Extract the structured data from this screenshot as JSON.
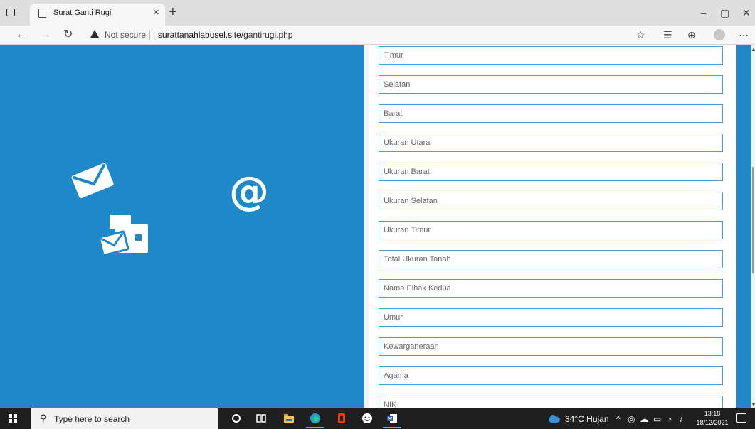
{
  "browser": {
    "tab_title": "Surat Ganti Rugi",
    "tab_close": "×",
    "new_tab": "+",
    "not_secure": "Not secure",
    "url_domain": "surattanahlabusel.site",
    "url_path": "/gantirugi.php",
    "window_controls": [
      "–",
      "▢",
      "✕"
    ],
    "tools": [
      "☆",
      "☰",
      "⊕",
      "⋯"
    ]
  },
  "form": {
    "fields": [
      {
        "placeholder": "Timur"
      },
      {
        "placeholder": "Selatan"
      },
      {
        "placeholder": "Barat"
      },
      {
        "placeholder": "Ukuran Utara"
      },
      {
        "placeholder": "Ukuran Barat"
      },
      {
        "placeholder": "Ukuran Selatan"
      },
      {
        "placeholder": "Ukuran Timur"
      },
      {
        "placeholder": "Total Ukuran Tanah"
      },
      {
        "placeholder": "Nama Pihak Kedua"
      },
      {
        "placeholder": "Umur"
      },
      {
        "placeholder": "Kewarganeraan"
      },
      {
        "placeholder": "Agama"
      },
      {
        "placeholder": "NIK"
      }
    ]
  },
  "decor": {
    "at_symbol": "@",
    "panel_color": "#1e88c9",
    "field_border_color": "#4a9fd4"
  },
  "taskbar": {
    "search_placeholder": "Type here to search",
    "weather": "34°C  Hujan",
    "time": "13:18",
    "date": "18/12/2021"
  }
}
